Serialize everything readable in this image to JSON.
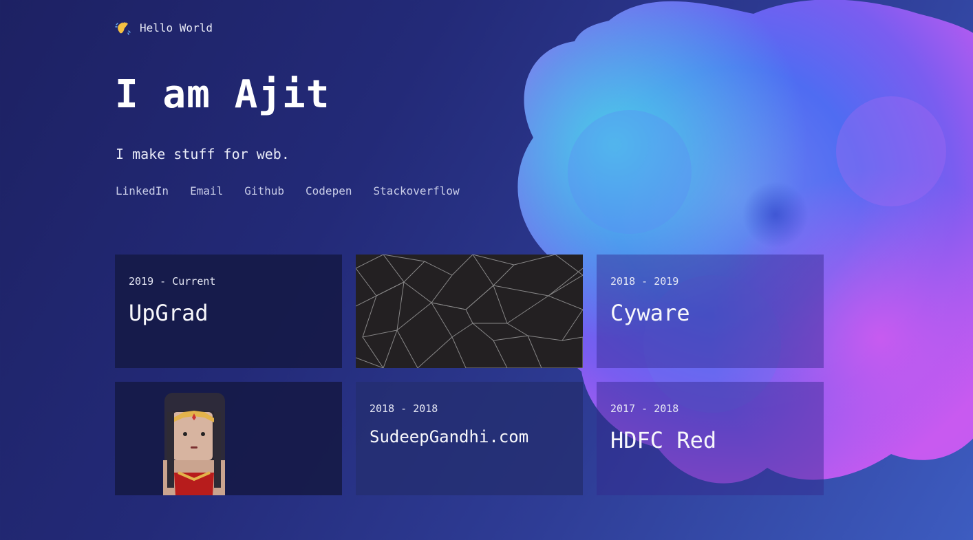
{
  "greeting": {
    "icon": "waving-hand-icon",
    "text": "Hello World"
  },
  "hero": {
    "title": "I am Ajit",
    "tagline": "I make stuff for web."
  },
  "social_links": [
    "LinkedIn",
    "Email",
    "Github",
    "Codepen",
    "Stackoverflow"
  ],
  "experience": [
    {
      "period": "2019 - Current",
      "company": "UpGrad"
    },
    {
      "period": "2018 - 2019",
      "company": "Cyware"
    },
    {
      "period": "2018 - 2018",
      "company": "SudeepGandhi.com"
    },
    {
      "period": "2017 - 2018",
      "company": "HDFC Red"
    }
  ],
  "images": {
    "mesh_tile": "triangle-mesh-image",
    "avatar_tile": "wonder-woman-avatar-image"
  },
  "colors": {
    "background_start": "#1d2163",
    "background_end": "#3d5cc0",
    "card_dark": "#161a48",
    "blob_blue": "#4e73f5",
    "blob_purple": "#b05af0",
    "blob_cyan": "#49d1e6"
  }
}
